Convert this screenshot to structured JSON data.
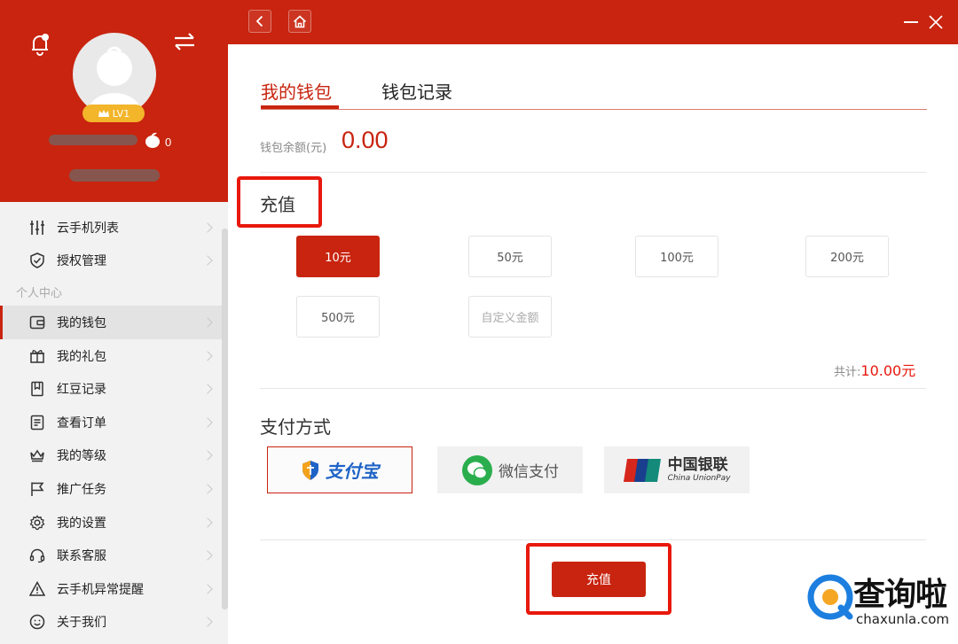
{
  "sidebar": {
    "level_badge": "LV1",
    "red_bean_count": "0",
    "section_personal": "个人中心",
    "items": [
      {
        "label": "云手机列表",
        "icon": "sliders-icon"
      },
      {
        "label": "授权管理",
        "icon": "shield-check-icon"
      },
      {
        "label": "我的钱包",
        "icon": "wallet-icon",
        "active": true
      },
      {
        "label": "我的礼包",
        "icon": "gift-icon"
      },
      {
        "label": "红豆记录",
        "icon": "bookmark-icon"
      },
      {
        "label": "查看订单",
        "icon": "order-icon"
      },
      {
        "label": "我的等级",
        "icon": "crown-icon"
      },
      {
        "label": "推广任务",
        "icon": "flag-icon"
      },
      {
        "label": "我的设置",
        "icon": "gear-icon"
      },
      {
        "label": "联系客服",
        "icon": "headset-icon"
      },
      {
        "label": "云手机异常提醒",
        "icon": "warning-icon"
      },
      {
        "label": "关于我们",
        "icon": "smile-icon"
      }
    ]
  },
  "topbar": {
    "back_icon": "chevron-left-icon",
    "home_icon": "home-icon"
  },
  "tabs": {
    "wallet": "我的钱包",
    "records": "钱包记录"
  },
  "balance": {
    "label": "钱包余额(元)",
    "value": "0.00"
  },
  "recharge": {
    "title": "充值",
    "amounts": [
      "10元",
      "50元",
      "100元",
      "200元",
      "500元"
    ],
    "selected_index": 0,
    "custom_placeholder": "自定义金额",
    "total_label": "共计:",
    "total_value": "10.00元"
  },
  "payment": {
    "title": "支付方式",
    "alipay": "支付宝",
    "wechat": "微信支付",
    "unionpay_cn": "中国银联",
    "unionpay_en": "China UnionPay"
  },
  "submit_label": "充值",
  "watermark": {
    "cn": "查询啦",
    "en": "chaxunla.com"
  },
  "colors": {
    "brand_red": "#c8240f",
    "highlight_red": "#e8180c"
  }
}
